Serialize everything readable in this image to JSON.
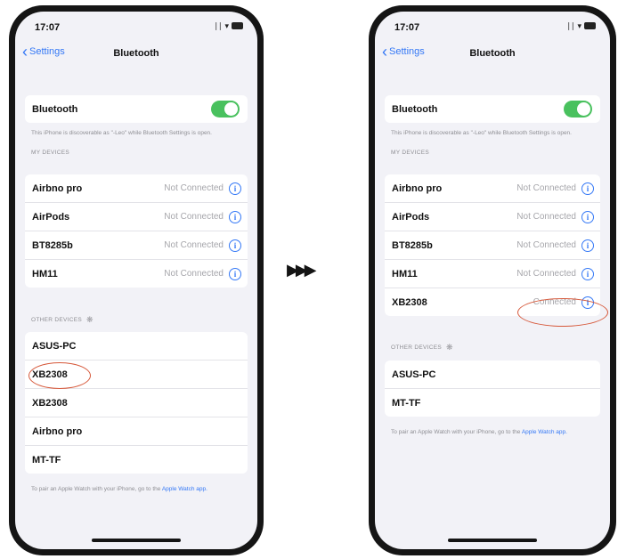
{
  "status_bar": {
    "time": "17:07"
  },
  "nav": {
    "back_label": "Settings",
    "title": "Bluetooth"
  },
  "bluetooth": {
    "label": "Bluetooth",
    "enabled": true
  },
  "discoverable_note": "This iPhone is discoverable as \"-Leo\" while Bluetooth Settings is open.",
  "my_devices_header": "MY DEVICES",
  "other_devices_header": "OTHER DEVICES",
  "watch_note_prefix": "To pair an Apple Watch with your iPhone, go to the",
  "watch_note_link": "Apple Watch app.",
  "left": {
    "my_devices": [
      {
        "name": "Airbno pro",
        "status": "Not Connected"
      },
      {
        "name": "AirPods",
        "status": "Not Connected"
      },
      {
        "name": "BT8285b",
        "status": "Not Connected"
      },
      {
        "name": "HM11",
        "status": "Not Connected"
      }
    ],
    "other_devices": [
      "ASUS-PC",
      "XB2308",
      "XB2308",
      "Airbno pro",
      "MT-TF"
    ]
  },
  "right": {
    "my_devices": [
      {
        "name": "Airbno pro",
        "status": "Not Connected"
      },
      {
        "name": "AirPods",
        "status": "Not Connected"
      },
      {
        "name": "BT8285b",
        "status": "Not Connected"
      },
      {
        "name": "HM11",
        "status": "Not Connected"
      },
      {
        "name": "XB2308",
        "status": "Connected"
      }
    ],
    "other_devices": [
      "ASUS-PC",
      "MT-TF"
    ]
  },
  "colors": {
    "accent": "#3478f6",
    "toggle_on": "#49c15e",
    "highlight": "#d6583a"
  }
}
